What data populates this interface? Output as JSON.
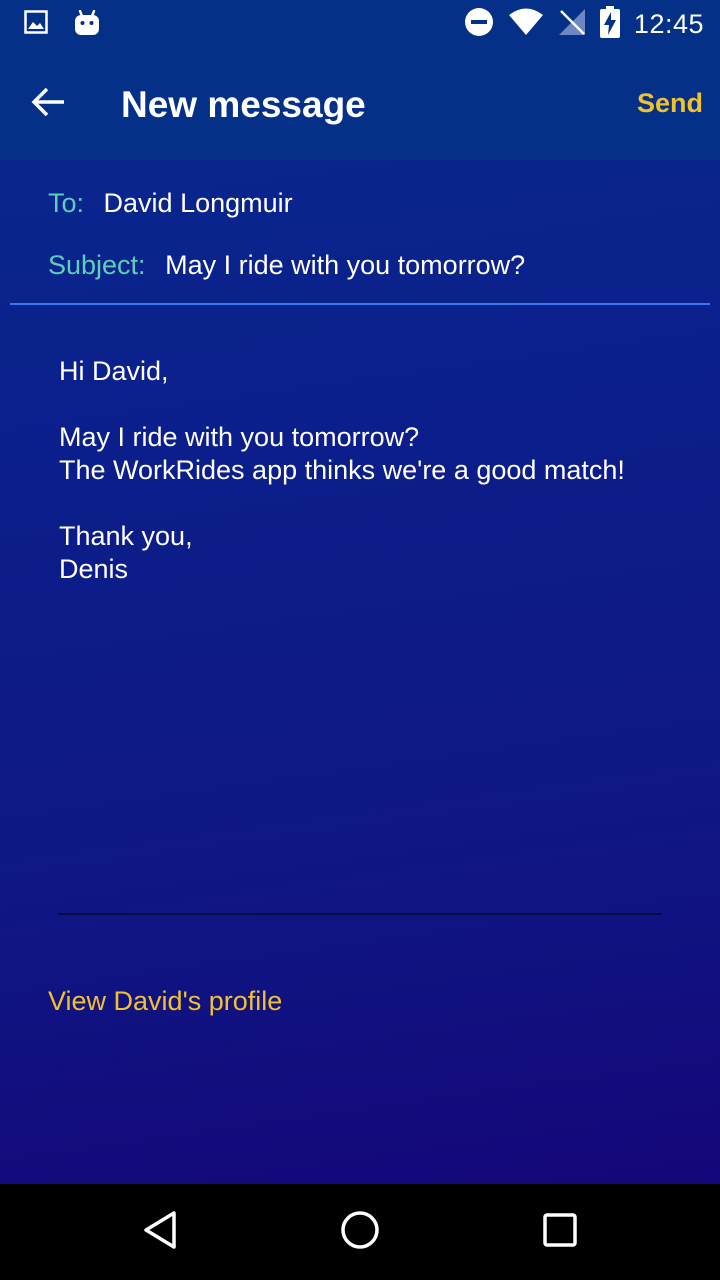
{
  "status_bar": {
    "time": "12:45",
    "left_icons": [
      "image-notification-icon",
      "android-notification-icon"
    ],
    "right_icons": [
      "do-not-disturb-icon",
      "wifi-icon",
      "no-signal-icon",
      "battery-charging-icon"
    ]
  },
  "app_bar": {
    "back_icon": "arrow-left-icon",
    "title": "New message",
    "send_label": "Send"
  },
  "compose": {
    "to_label": "To:",
    "to_value": "David Longmuir",
    "subject_label": "Subject:",
    "subject_value": "May I ride with you tomorrow?"
  },
  "message": {
    "greeting": "Hi David,",
    "line1": "May I ride with you tomorrow?",
    "line2": "The WorkRides app thinks we're a good match!",
    "closing": "Thank you,",
    "signature": "Denis"
  },
  "profile_link": "View David's profile",
  "nav_bar": {
    "icons": [
      "back-triangle-icon",
      "home-circle-icon",
      "recents-square-icon"
    ]
  },
  "colors": {
    "app_bar": "#043087",
    "accent_yellow": "#f2c12e",
    "label_teal": "#5ccfb6",
    "divider_blue": "#2f7cf0"
  }
}
